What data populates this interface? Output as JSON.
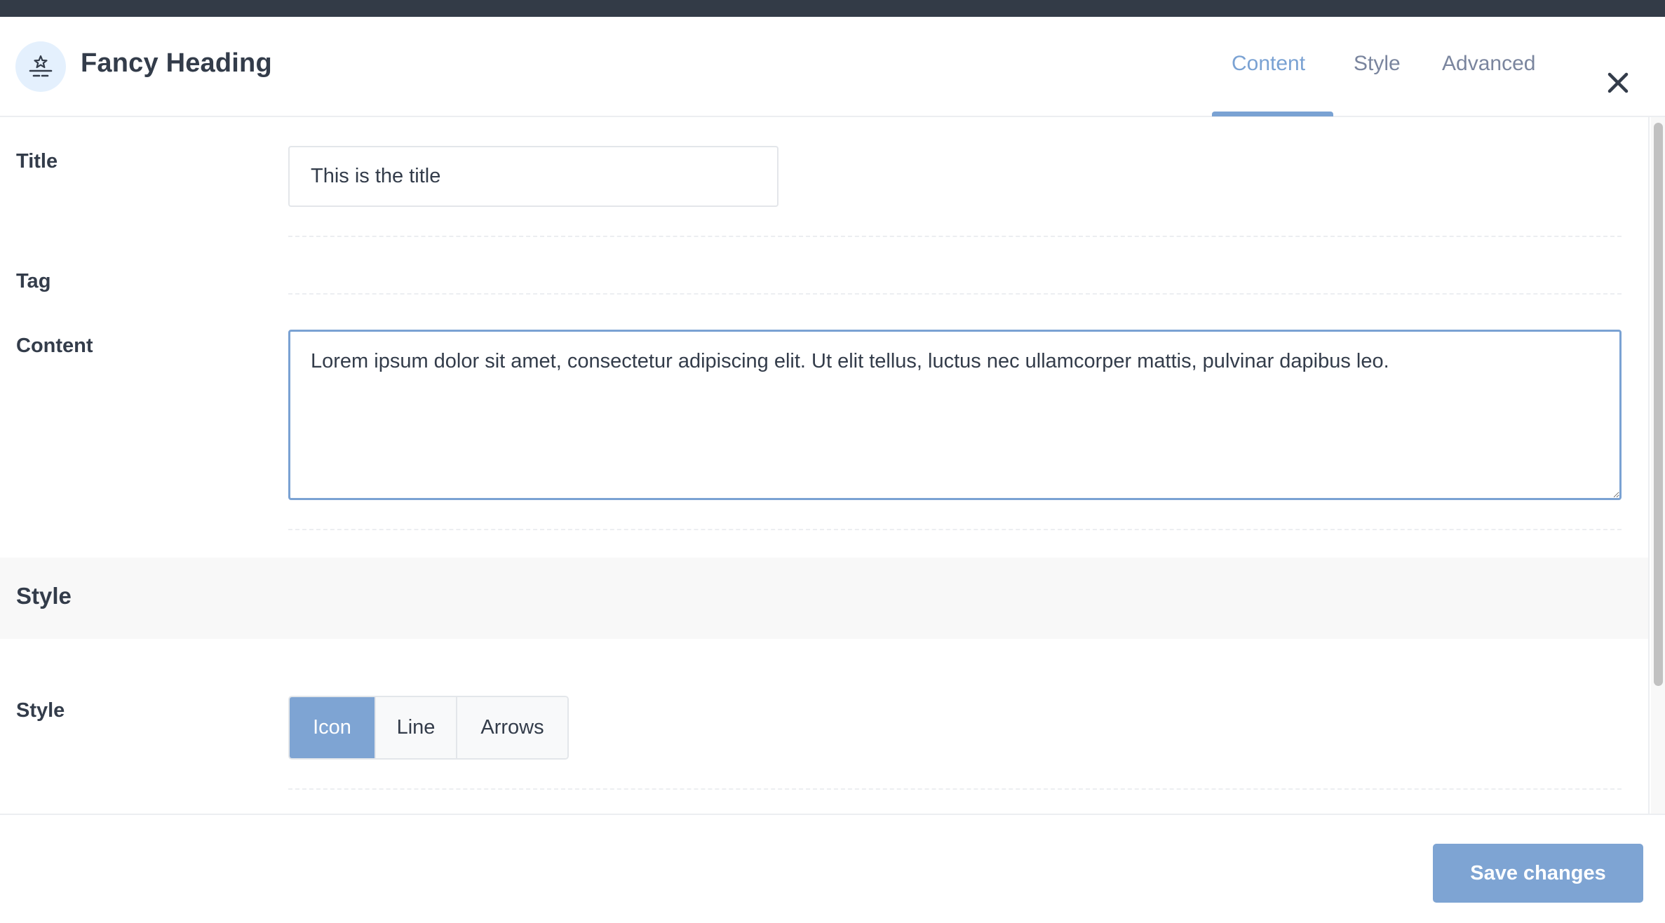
{
  "header": {
    "title": "Fancy Heading",
    "icon": "fancy-heading-icon",
    "tabs": [
      {
        "label": "Content",
        "active": true
      },
      {
        "label": "Style",
        "active": false
      },
      {
        "label": "Advanced",
        "active": false
      }
    ],
    "close_icon": "close-icon"
  },
  "form": {
    "title": {
      "label": "Title",
      "value": "This is the title"
    },
    "tag": {
      "label": "Tag"
    },
    "content": {
      "label": "Content",
      "value": "Lorem ipsum dolor sit amet, consectetur adipiscing elit. Ut elit tellus, luctus nec ullamcorper mattis, pulvinar dapibus leo."
    },
    "style_section": {
      "title": "Style"
    },
    "style": {
      "label": "Style",
      "options": [
        {
          "label": "Icon",
          "active": true
        },
        {
          "label": "Line",
          "active": false
        },
        {
          "label": "Arrows",
          "active": false
        }
      ]
    }
  },
  "footer": {
    "save_label": "Save changes"
  },
  "colors": {
    "accent": "#7ea4d3",
    "text": "#333c4a",
    "tab_inactive": "#7a859e",
    "topbar": "#333b47"
  }
}
